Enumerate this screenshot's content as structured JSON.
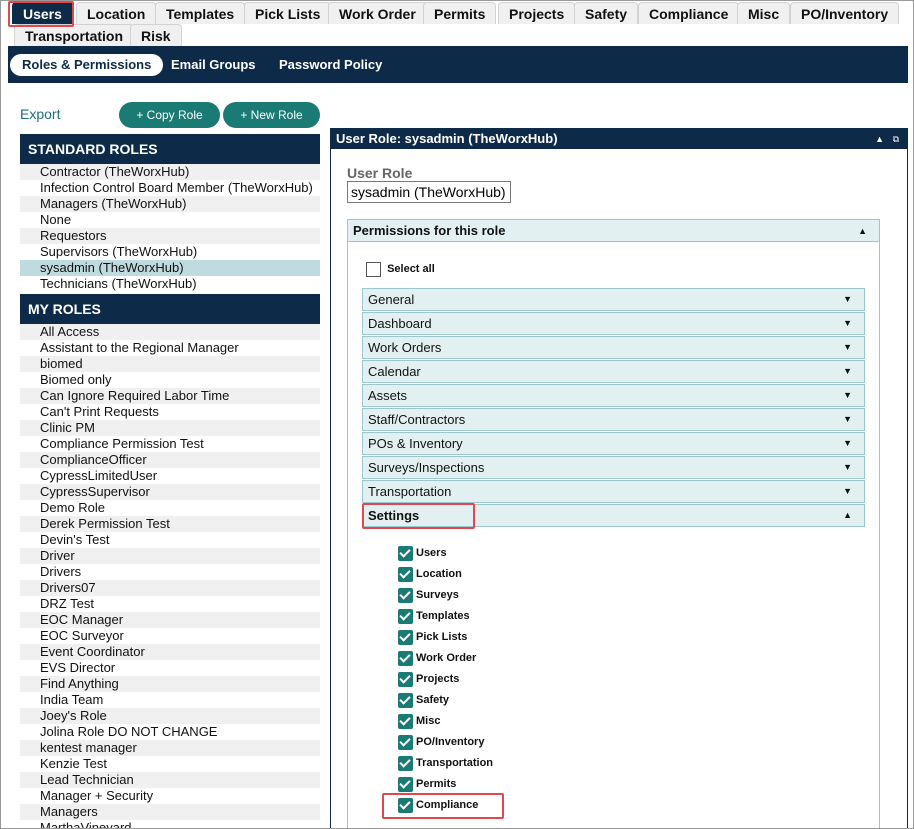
{
  "top_tabs": [
    "Users",
    "Location",
    "Templates",
    "Pick Lists",
    "Work Order",
    "Permits",
    "Projects",
    "Safety",
    "Compliance",
    "Misc",
    "PO/Inventory",
    "Transportation",
    "Risk"
  ],
  "sub_tabs": [
    "Roles & Permissions",
    "Email Groups",
    "Password Policy"
  ],
  "toolbar": {
    "export": "Export",
    "copy_role": "+ Copy Role",
    "new_role": "+ New Role"
  },
  "standard_roles": {
    "title": "STANDARD ROLES",
    "items": [
      "Contractor (TheWorxHub)",
      "Infection Control Board Member (TheWorxHub)",
      "Managers (TheWorxHub)",
      "None",
      "Requestors",
      "Supervisors (TheWorxHub)",
      "sysadmin (TheWorxHub)",
      "Technicians (TheWorxHub)"
    ],
    "selected": "sysadmin (TheWorxHub)"
  },
  "my_roles": {
    "title": "MY ROLES",
    "items": [
      "All Access",
      "Assistant to the Regional Manager",
      "biomed",
      "Biomed only",
      "Can Ignore Required Labor Time",
      "Can't Print Requests",
      "Clinic PM",
      "Compliance Permission Test",
      "ComplianceOfficer",
      "CypressLimitedUser",
      "CypressSupervisor",
      "Demo Role",
      "Derek Permission Test",
      "Devin's Test",
      "Driver",
      "Drivers",
      "Drivers07",
      "DRZ Test",
      "EOC Manager",
      "EOC Surveyor",
      "Event Coordinator",
      "EVS Director",
      "Find Anything",
      "India Team",
      "Joey's Role",
      "Jolina Role DO NOT CHANGE",
      "kentest manager",
      "Kenzie Test",
      "Lead Technician",
      "Manager + Security",
      "Managers",
      "MarthaVineyard"
    ]
  },
  "panel": {
    "title": "User Role: sysadmin (TheWorxHub)",
    "user_role_label": "User Role",
    "user_role_value": "sysadmin (TheWorxHub)",
    "permissions_header": "Permissions for this role",
    "select_all": "Select all",
    "sections": [
      "General",
      "Dashboard",
      "Work Orders",
      "Calendar",
      "Assets",
      "Staff/Contractors",
      "POs & Inventory",
      "Surveys/Inspections",
      "Transportation",
      "Settings"
    ],
    "expanded_section": "Settings",
    "settings_items": [
      "Users",
      "Location",
      "Surveys",
      "Templates",
      "Pick Lists",
      "Work Order",
      "Projects",
      "Safety",
      "Misc",
      "PO/Inventory",
      "Transportation",
      "Permits",
      "Compliance"
    ]
  }
}
